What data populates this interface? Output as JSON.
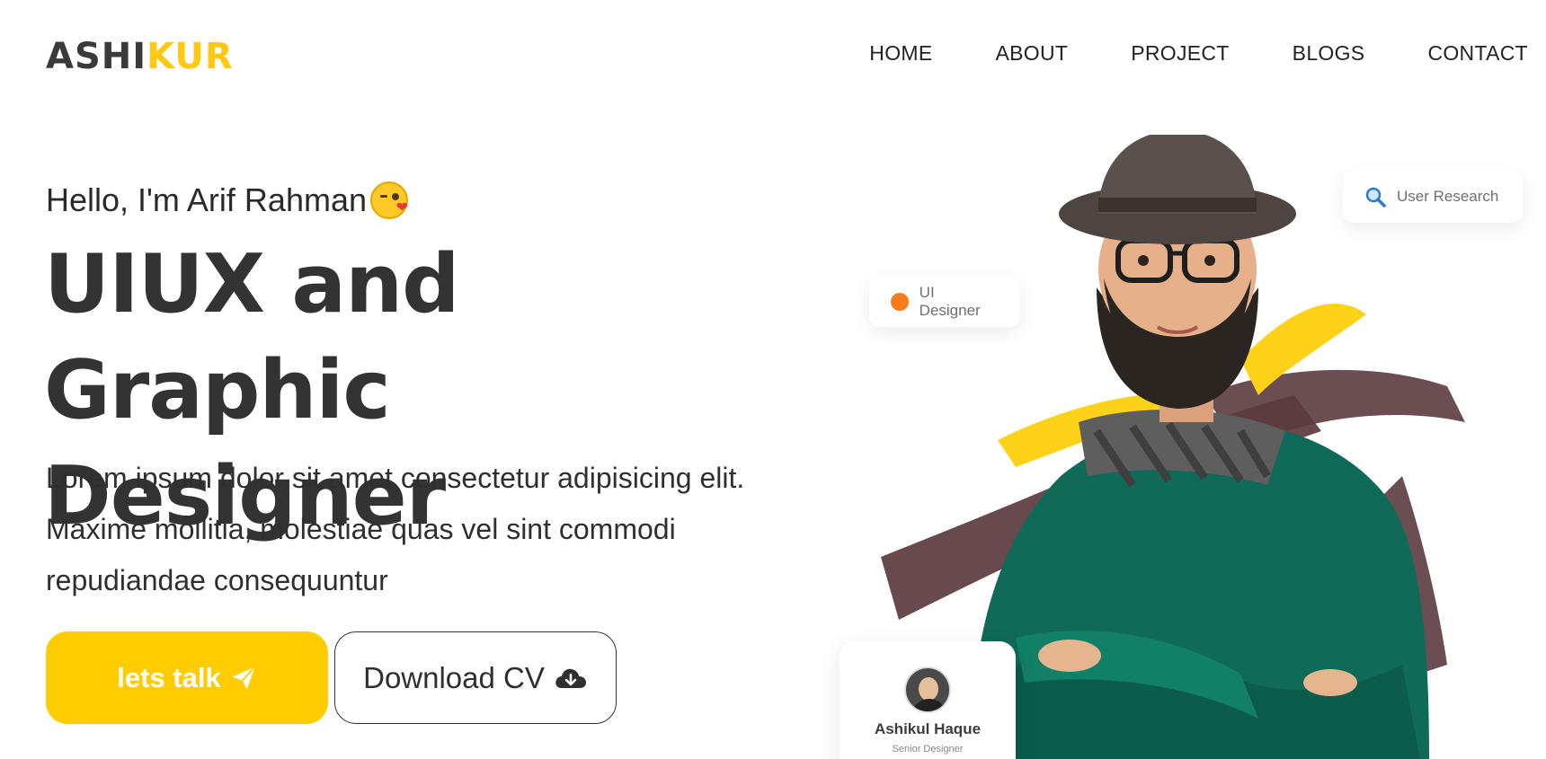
{
  "brand": {
    "logo_part1": "ASHI",
    "logo_part2": "KUR",
    "accent_color": "#ffcc00"
  },
  "nav": {
    "items": [
      {
        "label": "HOME"
      },
      {
        "label": "ABOUT"
      },
      {
        "label": "PROJECT"
      },
      {
        "label": "BLOGS"
      },
      {
        "label": "CONTACT"
      }
    ]
  },
  "hero": {
    "greeting": "Hello, I'm Arif Rahman",
    "greeting_emoji": "kissing-face-emoji",
    "title_line1": "UIUX and Graphic",
    "title_line2": "Designer",
    "description": "Lorem ipsum dolor sit amet consectetur adipisicing elit. Maxime mollitia, molestiae quas vel sint commodi repudiandae consequuntur"
  },
  "buttons": {
    "primary_label": "lets talk",
    "primary_icon": "paper-plane-icon",
    "secondary_label": "Download CV",
    "secondary_icon": "cloud-download-icon"
  },
  "chips": {
    "search_label": "User Research",
    "search_icon": "magnifier-icon",
    "ui_label": "UI Designer",
    "ui_dot_color": "#f77d1b"
  },
  "profile_card": {
    "name": "Ashikul Haque",
    "role": "Senior Designer"
  }
}
